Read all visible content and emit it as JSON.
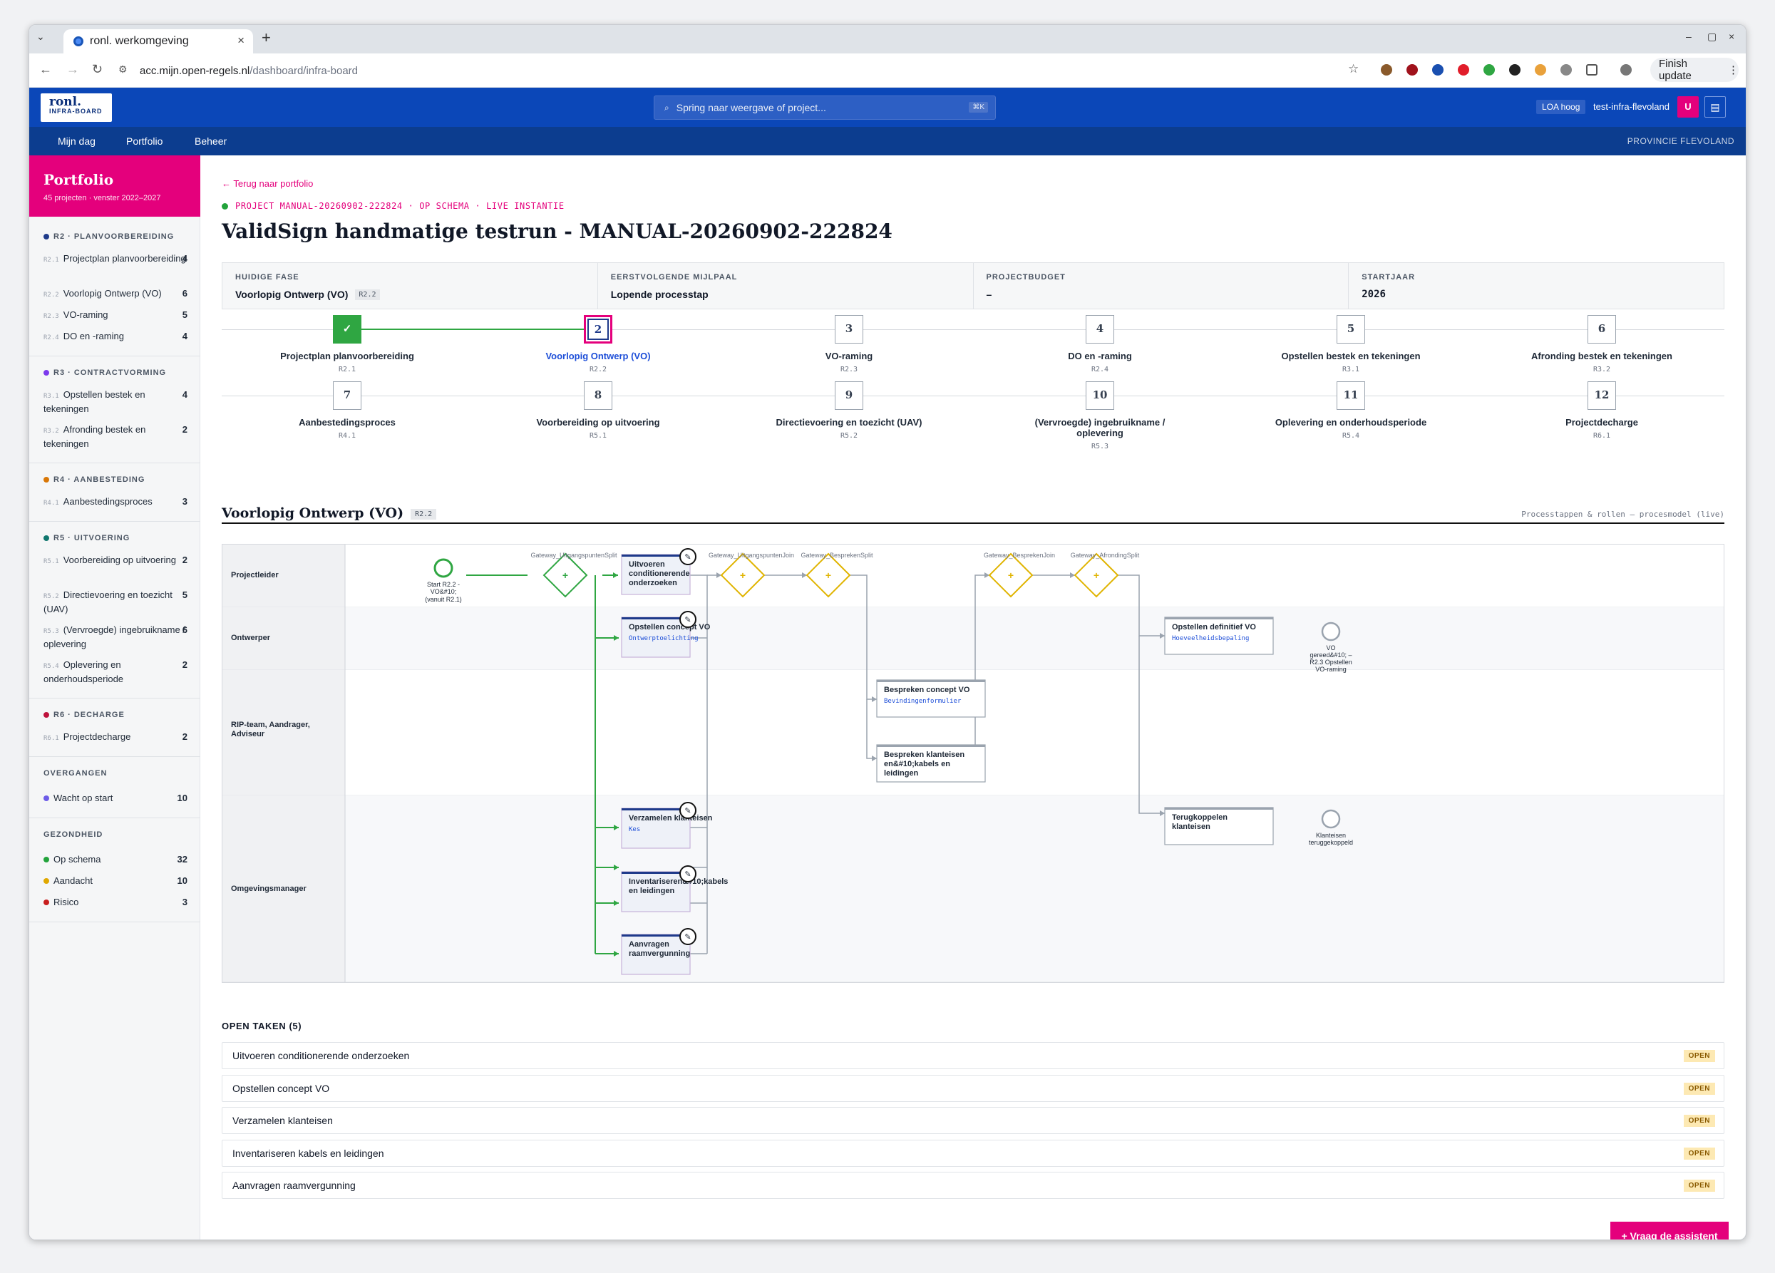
{
  "browser": {
    "tab_title": "ronl. werkomgeving",
    "url_host": "acc.mijn.open-regels.nl",
    "url_path": "/dashboard/infra-board",
    "finish_update": "Finish update"
  },
  "app": {
    "logo_main": "ronl.",
    "logo_sub": "INFRA-BOARD",
    "search_placeholder": "Spring naar weergave of project...",
    "search_shortcut": "⌘K",
    "loa": "LOA hoog",
    "user": "test-infra-flevoland",
    "avatar": "U",
    "nav": [
      "Mijn dag",
      "Portfolio",
      "Beheer"
    ],
    "org": "PROVINCIE FLEVOLAND"
  },
  "sidebar": {
    "title": "Portfolio",
    "subtitle": "45 projecten · venster 2022–2027",
    "groups": [
      {
        "code": "R2",
        "label": "R2 · PLANVOORBEREIDING",
        "color": "#1e3a8a",
        "items": [
          {
            "code": "R2.1",
            "label": "Projectplan planvoorbereiding",
            "count": "4"
          },
          {
            "code": "R2.2",
            "label": "Voorlopig Ontwerp (VO)",
            "count": "6"
          },
          {
            "code": "R2.3",
            "label": "VO-raming",
            "count": "5"
          },
          {
            "code": "R2.4",
            "label": "DO en -raming",
            "count": "4"
          }
        ]
      },
      {
        "code": "R3",
        "label": "R3 · CONTRACTVORMING",
        "color": "#7c3aed",
        "items": [
          {
            "code": "R3.1",
            "label": "Opstellen bestek en tekeningen",
            "count": "4"
          },
          {
            "code": "R3.2",
            "label": "Afronding bestek en tekeningen",
            "count": "2"
          }
        ]
      },
      {
        "code": "R4",
        "label": "R4 · AANBESTEDING",
        "color": "#d97706",
        "items": [
          {
            "code": "R4.1",
            "label": "Aanbestedingsproces",
            "count": "3"
          }
        ]
      },
      {
        "code": "R5",
        "label": "R5 · UITVOERING",
        "color": "#0f766e",
        "items": [
          {
            "code": "R5.1",
            "label": "Voorbereiding op uitvoering",
            "count": "2"
          },
          {
            "code": "R5.2",
            "label": "Directievoering en toezicht (UAV)",
            "count": "5"
          },
          {
            "code": "R5.3",
            "label": "(Vervroegde) ingebruikname / oplevering",
            "count": "6"
          },
          {
            "code": "R5.4",
            "label": "Oplevering en onderhoudsperiode",
            "count": "2"
          }
        ]
      },
      {
        "code": "R6",
        "label": "R6 · DECHARGE",
        "color": "#be123c",
        "items": [
          {
            "code": "R6.1",
            "label": "Projectdecharge",
            "count": "2"
          }
        ]
      }
    ],
    "transitions": {
      "label": "OVERGANGEN",
      "items": [
        {
          "label": "Wacht op start",
          "count": "10",
          "color": "#6d5ce8"
        }
      ]
    },
    "health": {
      "label": "GEZONDHEID",
      "items": [
        {
          "label": "Op schema",
          "count": "32",
          "color": "#22a33b"
        },
        {
          "label": "Aandacht",
          "count": "10",
          "color": "#e0a800"
        },
        {
          "label": "Risico",
          "count": "3",
          "color": "#c81e1e"
        }
      ]
    }
  },
  "project": {
    "back": "← Terug naar portfolio",
    "meta": "PROJECT MANUAL-20260902-222824 · OP SCHEMA · LIVE INSTANTIE",
    "title": "ValidSign handmatige testrun - MANUAL-20260902-222824",
    "facts": [
      {
        "label": "HUIDIGE FASE",
        "value": "Voorlopig Ontwerp (VO)",
        "badge": "R2.2"
      },
      {
        "label": "EERSTVOLGENDE MIJLPAAL",
        "value": "Lopende processtap",
        "badge": ""
      },
      {
        "label": "PROJECTBUDGET",
        "value": "–",
        "badge": ""
      },
      {
        "label": "STARTJAAR",
        "value": "2026",
        "badge": ""
      }
    ],
    "steps": [
      {
        "n": "✓",
        "label": "Projectplan planvoorbereiding",
        "code": "R2.1",
        "state": "done"
      },
      {
        "n": "2",
        "label": "Voorlopig Ontwerp (VO)",
        "code": "R2.2",
        "state": "current"
      },
      {
        "n": "3",
        "label": "VO-raming",
        "code": "R2.3",
        "state": ""
      },
      {
        "n": "4",
        "label": "DO en -raming",
        "code": "R2.4",
        "state": ""
      },
      {
        "n": "5",
        "label": "Opstellen bestek en tekeningen",
        "code": "R3.1",
        "state": ""
      },
      {
        "n": "6",
        "label": "Afronding bestek en tekeningen",
        "code": "R3.2",
        "state": ""
      },
      {
        "n": "7",
        "label": "Aanbestedingsproces",
        "code": "R4.1",
        "state": ""
      },
      {
        "n": "8",
        "label": "Voorbereiding op uitvoering",
        "code": "R5.1",
        "state": ""
      },
      {
        "n": "9",
        "label": "Directievoering en toezicht (UAV)",
        "code": "R5.2",
        "state": ""
      },
      {
        "n": "10",
        "label": "(Vervroegde) ingebruikname / oplevering",
        "code": "R5.3",
        "state": ""
      },
      {
        "n": "11",
        "label": "Oplevering en onderhoudsperiode",
        "code": "R5.4",
        "state": ""
      },
      {
        "n": "12",
        "label": "Projectdecharge",
        "code": "R6.1",
        "state": ""
      }
    ]
  },
  "process": {
    "title": "Voorlopig Ontwerp (VO)",
    "badge": "R2.2",
    "caption": "Processtappen & rollen — procesmodel (live)",
    "lanes": [
      "Projectleider",
      "Ontwerper",
      "RIP-team, Aandrager, Adviseur",
      "Omgevingsmanager"
    ],
    "start_label": [
      "Start R2.2 -",
      "VO&#10;",
      "(vanuit R2.1)"
    ],
    "gateways": [
      "Gateway_UitgangspuntenSplit",
      "Gateway_UitgangspuntenJoin",
      "Gateway_BesprekenSplit",
      "Gateway_BesprekenJoin",
      "Gateway_AfrondingSplit"
    ],
    "tasks": {
      "uitvoeren": [
        "Uitvoeren",
        "conditionerende",
        "onderzoeken"
      ],
      "concept": [
        "Opstellen concept VO"
      ],
      "concept_form": "Ontwerptoelichting",
      "bespreken_concept": [
        "Bespreken concept VO"
      ],
      "bespreken_concept_form": "Bevindingenformulier",
      "bespreken_klant": [
        "Bespreken klanteisen",
        "en&#10;kabels en",
        "leidingen"
      ],
      "definitief": [
        "Opstellen definitief VO"
      ],
      "definitief_form": "Hoeveelheidsbepaling",
      "verzamelen": [
        "Verzamelen klanteisen"
      ],
      "verzamelen_form": "Kes",
      "inventariseren": [
        "Inventariseren&#10;kabels",
        "en leidingen"
      ],
      "aanvragen": [
        "Aanvragen",
        "raamvergunning"
      ],
      "terugkoppelen": [
        "Terugkoppelen",
        "klanteisen"
      ]
    },
    "end1": [
      "VO",
      "gereed&#10; –",
      "R2.3 Opstellen",
      "VO-raming"
    ],
    "end2": [
      "Klanteisen",
      "teruggekoppeld"
    ]
  },
  "open_tasks": {
    "label": "OPEN TAKEN (5)",
    "items": [
      {
        "label": "Uitvoeren conditionerende onderzoeken",
        "status": "OPEN"
      },
      {
        "label": "Opstellen concept VO",
        "status": "OPEN"
      },
      {
        "label": "Verzamelen klanteisen",
        "status": "OPEN"
      },
      {
        "label": "Inventariseren kabels en leidingen",
        "status": "OPEN"
      },
      {
        "label": "Aanvragen raamvergunning",
        "status": "OPEN"
      }
    ]
  },
  "assistant": "+ Vraag de assistent",
  "colors": {
    "brand": "#e4007c",
    "header": "#0b47b8",
    "subnav": "#0c3d8f",
    "done": "#2fa642"
  }
}
